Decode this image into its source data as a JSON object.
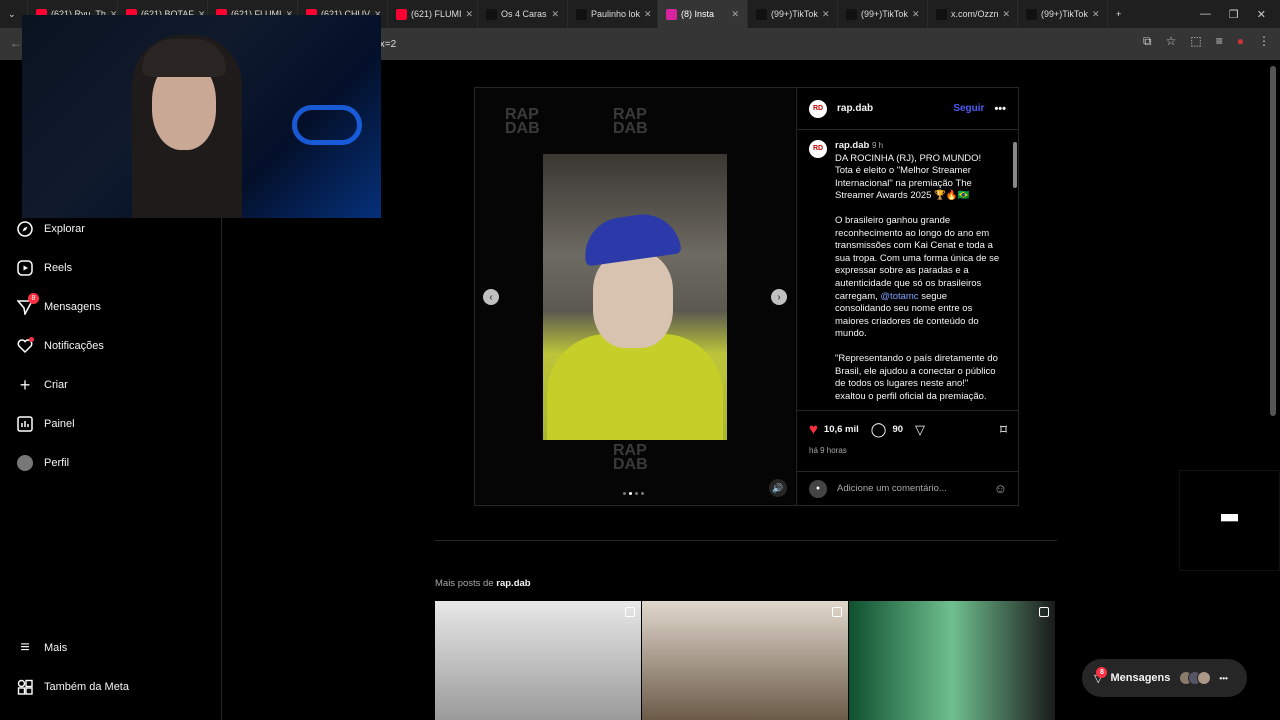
{
  "tabs": [
    {
      "title": "(621) Ryu, Th",
      "color": "#ff0033"
    },
    {
      "title": "(621) BOTAF",
      "color": "#ff0033"
    },
    {
      "title": "(621) FLUMI",
      "color": "#ff0033"
    },
    {
      "title": "(621) CHUV",
      "color": "#ff0033"
    },
    {
      "title": "(621) FLUMI",
      "color": "#ff0033"
    },
    {
      "title": "Os 4 Caras",
      "color": "#111111"
    },
    {
      "title": "Paulinho lok",
      "color": "#111111"
    },
    {
      "title": "(8) Insta",
      "color": "#d6249f"
    },
    {
      "title": "(99+)TikTok",
      "color": "#111111"
    },
    {
      "title": "(99+)TikTok",
      "color": "#111111"
    },
    {
      "title": "x.com/Ozzn",
      "color": "#111111"
    },
    {
      "title": "(99+)TikTok",
      "color": "#111111"
    }
  ],
  "url": "lex=2",
  "sidebar": {
    "items": [
      {
        "label": "Explorar",
        "icon": "compass-icon"
      },
      {
        "label": "Reels",
        "icon": "reels-icon"
      },
      {
        "label": "Mensagens",
        "icon": "messenger-icon",
        "badge": "8"
      },
      {
        "label": "Notificações",
        "icon": "heart-icon"
      },
      {
        "label": "Criar",
        "icon": "plus-icon"
      },
      {
        "label": "Painel",
        "icon": "dashboard-icon"
      },
      {
        "label": "Perfil",
        "icon": "profile-icon"
      }
    ],
    "bottom": [
      {
        "label": "Mais",
        "icon": "menu-icon"
      },
      {
        "label": "Também da Meta",
        "icon": "meta-icon"
      }
    ]
  },
  "post": {
    "username": "rap.dab",
    "follow": "Seguir",
    "time_ago": "9 h",
    "caption_lines": [
      "DA ROCINHA (RJ), PRO MUNDO! Tota é eleito o \"Melhor Streamer Internacional\" na premiação The Streamer Awards 2025 🏆🔥🇧🇷",
      "O brasileiro ganhou grande reconhecimento ao longo do ano em transmissões com Kai Cenat e toda a sua tropa. Com uma forma única de se expressar sobre as paradas e a autenticidade que só os brasileiros carregam,",
      "@totamc",
      "segue consolidando seu nome entre os maiores criadores de conteúdo do mundo.",
      "\"Representando o país diretamente do Brasil, ele ajudou a conectar o público de todos os lugares neste ano!\" exaltou o perfil oficial da premiação. 🤝🏼"
    ],
    "likes": "10,6 mil",
    "comments": "90",
    "posted": "há 9 horas",
    "comment_placeholder": "Adicione um comentário..."
  },
  "more_posts": {
    "prefix": "Mais posts de",
    "user": "rap.dab"
  },
  "messages_pill": {
    "label": "Mensagens",
    "badge": "8"
  }
}
